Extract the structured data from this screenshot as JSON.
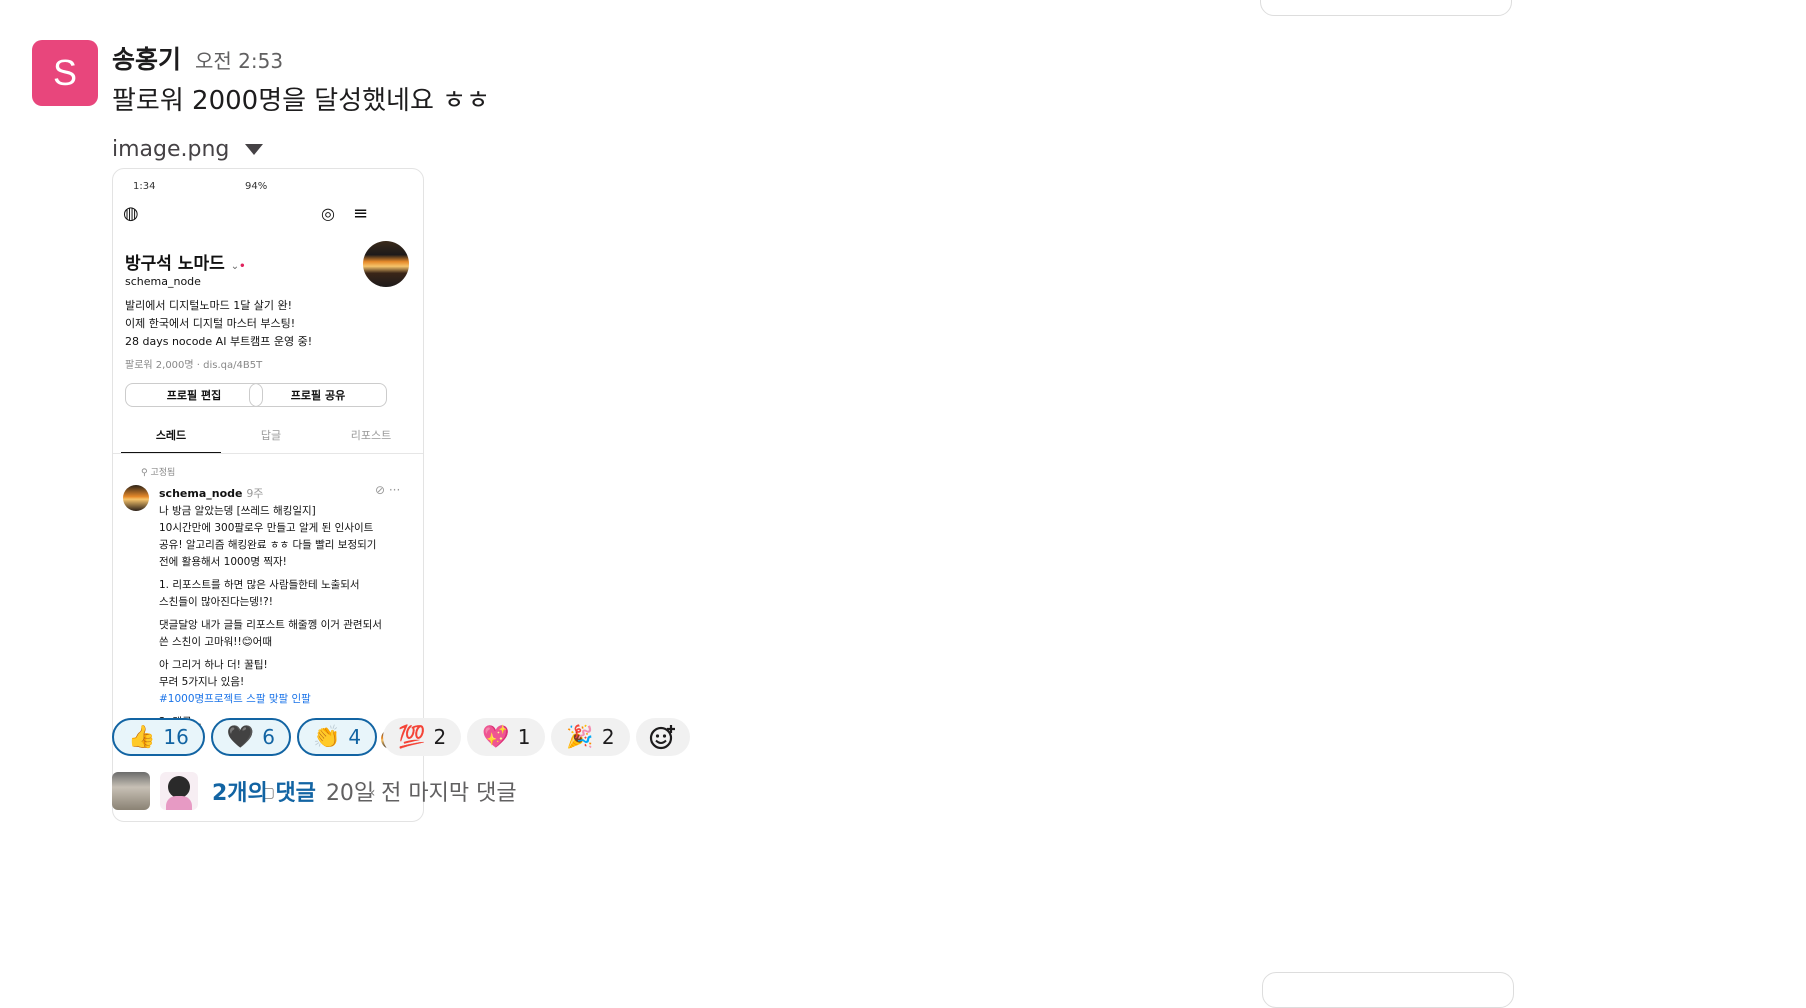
{
  "message": {
    "avatar_letter": "S",
    "avatar_color": "#e8467c",
    "author": "송홍기",
    "time": "오전 2:53",
    "text": "팔로워 2000명을 달성했네요 ㅎㅎ",
    "attachment": {
      "filename": "image.png",
      "screenshot": {
        "status_time": "1:34",
        "status_right": "94%",
        "profile_name": "방구석 노마드",
        "handle": "schema_node",
        "bio": [
          "발리에서 디지털노마드 1달 살기 완!",
          "이제 한국에서 디지털 마스터 부스팅!",
          "28 days nocode AI 부트캠프 운영 중!"
        ],
        "followers": "팔로워 2,000명 · dis.qa/4B5T",
        "edit_button": "프로필 편집",
        "share_button": "프로필 공유",
        "tabs": [
          "스레드",
          "답글",
          "리포스트"
        ],
        "pinned_label": "고정됨",
        "post_user": "schema_node",
        "post_ago": "9주",
        "post_lines": [
          "나 방금 알았는뎅 [쓰레드 해킹일지]",
          "10시간만에 300팔로우 만들고 알게 된 인사이트",
          "공유! 알고리즘 해킹완료 ㅎㅎ 다들 빨리 보정되기",
          "전에 활용해서 1000명 찍자!"
        ],
        "post_point1": [
          "1. 리포스트를 하면 많은 사람들한테 노출되서",
          "스친들이 많아진다는뎅!?!"
        ],
        "post_point2": [
          "댓글달앙 내가 글들 리포스트 해줄껭 이거 관련되서",
          "쓴 스친이 고마워!!😊어때"
        ],
        "post_point3": [
          "아 그리거 하나 더! 꿀팁!",
          "무려 5가지나 있음!"
        ],
        "post_tag": "#1000명프로젝트 스팔 맞팔 인팔",
        "post_more": "2. 댓글..."
      }
    },
    "reactions": [
      {
        "emoji": "👍",
        "count": "16",
        "mine": true
      },
      {
        "emoji": "🖤",
        "count": "6",
        "mine": true
      },
      {
        "emoji": "👏",
        "count": "4",
        "mine": true
      },
      {
        "emoji": "💯",
        "count": "2",
        "mine": false
      },
      {
        "emoji": "💖",
        "count": "1",
        "mine": false
      },
      {
        "emoji": "🎉",
        "count": "2",
        "mine": false
      }
    ],
    "add_reaction_icon": "add-emoji-icon",
    "thread": {
      "reply_count": "2개의 댓글",
      "last_reply": "20일 전 마지막 댓글"
    }
  }
}
